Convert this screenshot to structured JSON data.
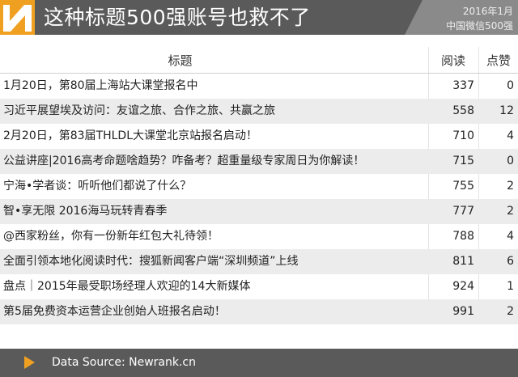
{
  "header": {
    "title": "这种标题500强账号也救不了",
    "date": "2016年1月",
    "subtitle": "中国微信500强",
    "logo_color": "#f0a020"
  },
  "table": {
    "columns": [
      "标题",
      "阅读",
      "点赞"
    ],
    "rows": [
      {
        "title": "1月20日，第80届上海站大课堂报名中",
        "reads": "337",
        "likes": "0"
      },
      {
        "title": "习近平展望埃及访问：友谊之旅、合作之旅、共赢之旅",
        "reads": "558",
        "likes": "12"
      },
      {
        "title": "2月20日，第83届THLDL大课堂北京站报名启动！",
        "reads": "710",
        "likes": "4"
      },
      {
        "title": "公益讲座|2016高考命题啥趋势？咋备考？超重量级专家周日为你解读！",
        "reads": "715",
        "likes": "0"
      },
      {
        "title": "宁海•学者谈：听听他们都说了什么？",
        "reads": "755",
        "likes": "2"
      },
      {
        "title": "智•享无限 2016海马玩转青春季",
        "reads": "777",
        "likes": "2"
      },
      {
        "title": "@西家粉丝，你有一份新年红包大礼待领！",
        "reads": "788",
        "likes": "4"
      },
      {
        "title": "全面引领本地化阅读时代：搜狐新闻客户端“深圳频道”上线",
        "reads": "811",
        "likes": "6"
      },
      {
        "title": "盘点｜2015年最受职场经理人欢迎的14大新媒体",
        "reads": "924",
        "likes": "1"
      },
      {
        "title": "第5届免费资本运营企业创始人班报名启动！",
        "reads": "991",
        "likes": "2"
      }
    ]
  },
  "footer": {
    "source": "Data Source: Newrank.cn",
    "icon": "play-triangle-icon"
  }
}
